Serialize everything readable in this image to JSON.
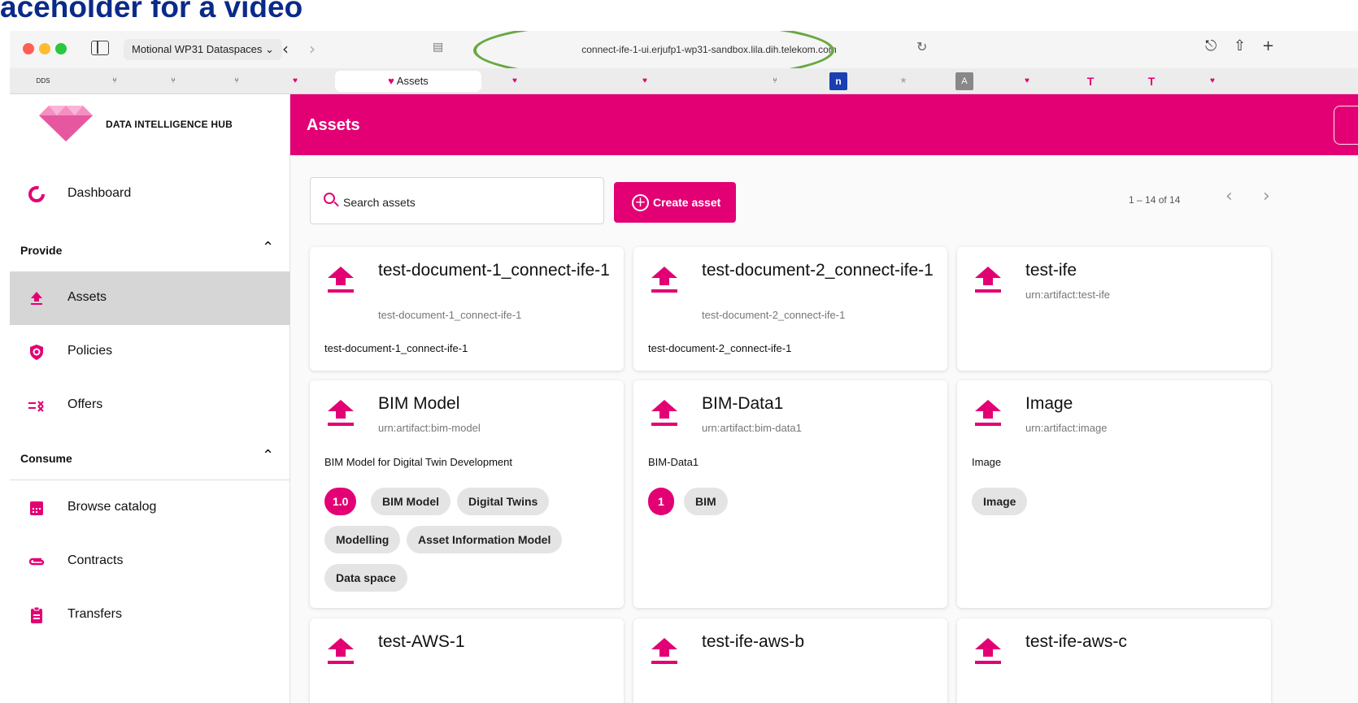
{
  "slide": {
    "title": "aceholder for a video"
  },
  "browser": {
    "tab_group": "Motional WP31 Dataspaces",
    "tab_group_caret": "⌄",
    "url": "connect-ife-1-ui.erjufp1-wp31-sandbox.lila.dih.telekom.com",
    "active_tab": "Assets",
    "favorites": [
      "DDS",
      "⑂",
      "⑂",
      "⑂",
      "♥",
      "♥",
      "♥",
      "⑂",
      "n",
      "★",
      "A",
      "♥",
      "T",
      "T",
      "♥"
    ],
    "colors": {
      "accent": "#e20074",
      "highlight_oval": "#6aa843"
    }
  },
  "app": {
    "logo_text": "DATA INTELLIGENCE HUB",
    "page_title": "Assets"
  },
  "sidebar": {
    "dashboard": "Dashboard",
    "provide": "Provide",
    "assets": "Assets",
    "policies": "Policies",
    "offers": "Offers",
    "consume": "Consume",
    "browse_catalog": "Browse catalog",
    "contracts": "Contracts",
    "transfers": "Transfers"
  },
  "toolbar": {
    "search_placeholder": "Search assets",
    "create_label": "Create asset",
    "pagination": "1 – 14 of 14"
  },
  "cards": [
    {
      "title": "test-document-1_connect-ife-1",
      "sub": "test-document-1_connect-ife-1",
      "desc": "test-document-1_connect-ife-1"
    },
    {
      "title": "test-document-2_connect-ife-1",
      "sub": "test-document-2_connect-ife-1",
      "desc": "test-document-2_connect-ife-1"
    },
    {
      "title": "test-ife",
      "sub": "urn:artifact:test-ife",
      "desc": ""
    },
    {
      "title": "BIM Model",
      "sub": "urn:artifact:bim-model",
      "desc": "BIM Model for Digital Twin Development",
      "chips": [
        "1.0",
        "BIM Model",
        "Digital Twins",
        "Modelling",
        "Asset Information Model",
        "Data space"
      ]
    },
    {
      "title": "BIM-Data1",
      "sub": "urn:artifact:bim-data1",
      "desc": "BIM-Data1",
      "chips": [
        "1",
        "BIM"
      ]
    },
    {
      "title": "Image",
      "sub": "urn:artifact:image",
      "desc": "Image",
      "chips": [
        "Image"
      ]
    },
    {
      "title": "test-AWS-1"
    },
    {
      "title": "test-ife-aws-b"
    },
    {
      "title": "test-ife-aws-c"
    }
  ]
}
